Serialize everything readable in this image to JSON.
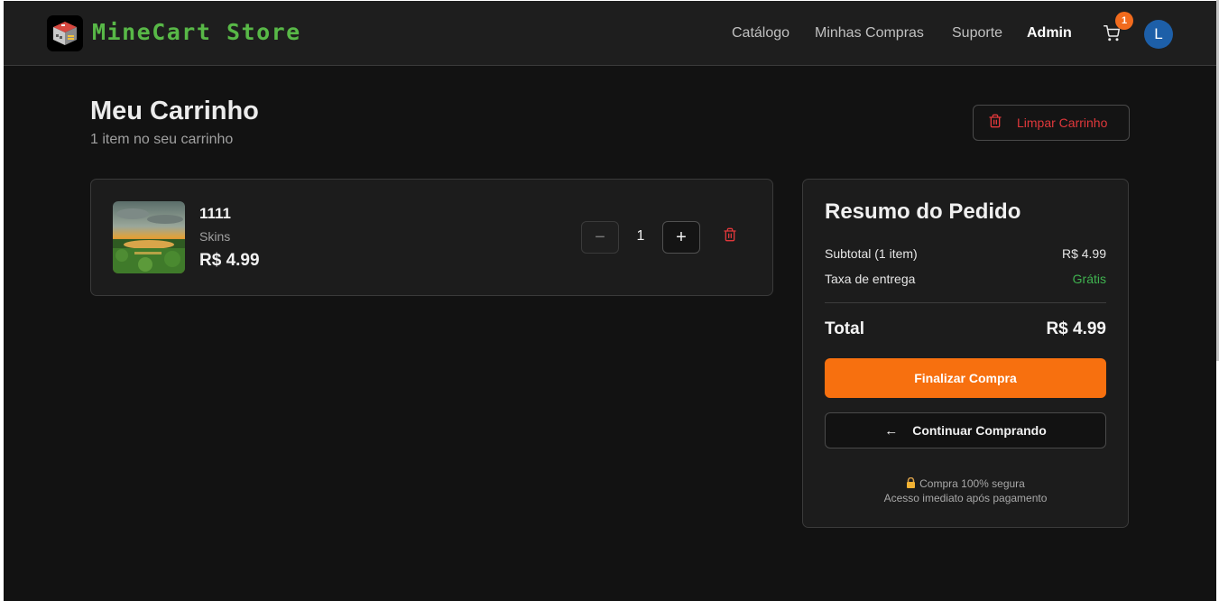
{
  "header": {
    "brand": "MineCart Store",
    "nav": [
      "Catálogo",
      "Minhas Compras",
      "Suporte",
      "Admin"
    ],
    "cart_count": "1",
    "avatar_initial": "L"
  },
  "page": {
    "title": "Meu Carrinho",
    "subtitle": "1 item no seu carrinho",
    "clear_label": "Limpar Carrinho"
  },
  "items": [
    {
      "name": "1111",
      "category": "Skins",
      "price": "R$ 4.99",
      "quantity": "1",
      "minus": "−",
      "plus": "+"
    }
  ],
  "summary": {
    "title": "Resumo do Pedido",
    "subtotal_label": "Subtotal (1 item)",
    "subtotal_value": "R$ 4.99",
    "shipping_label": "Taxa de entrega",
    "shipping_value": "Grátis",
    "total_label": "Total",
    "total_value": "R$ 4.99",
    "checkout_label": "Finalizar Compra",
    "continue_arrow": "←",
    "continue_label": "Continuar Comprando",
    "secure_text": "Compra 100% segura",
    "access_text": "Acesso imediato após pagamento"
  },
  "colors": {
    "background": "#121212",
    "card": "#1c1c1c",
    "accent_orange": "#f7700f",
    "brand_green": "#58b847",
    "danger_red": "#e0383b",
    "free_green": "#3fb24f",
    "avatar_blue": "#1d5fa8"
  },
  "icons": [
    "minecraft-block-logo-icon",
    "cart-icon",
    "trash-icon",
    "arrow-left-icon",
    "lock-icon"
  ]
}
